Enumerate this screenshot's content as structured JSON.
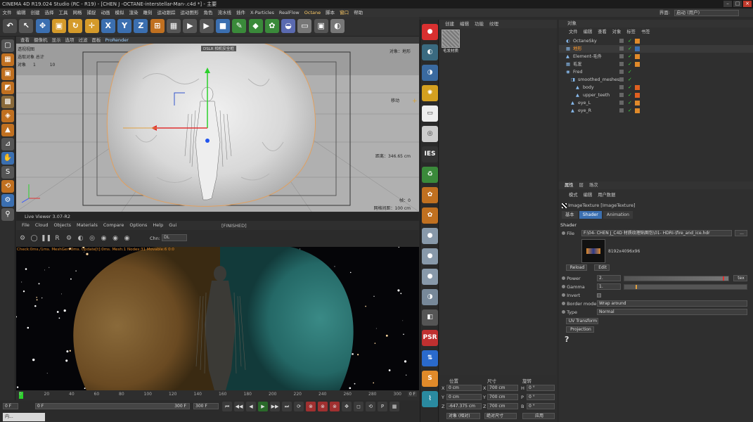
{
  "titlebar": {
    "title": "CINEMA 4D R19.024 Studio (RC - R19) - [CHEN J -OCTANE-interstellar-Man-.c4d *] - 主要"
  },
  "menu": {
    "items": [
      "文件",
      "编辑",
      "创建",
      "选择",
      "工具",
      "网格",
      "捕捉",
      "动画",
      "模拟",
      "渲染",
      "雕刻",
      "运动跟踪",
      "运动图形",
      "角色",
      "流水线",
      "插件",
      "X-Particles",
      "RealFlow",
      "Octane",
      "脚本",
      "窗口",
      "帮助"
    ],
    "layout_label": "界面:",
    "layout_value": "启动 (用户)"
  },
  "toolbar": {
    "buttons": [
      "undo",
      "select",
      "move",
      "scale",
      "rotate",
      "move-axis",
      "X",
      "Y",
      "Z",
      "coord",
      "render-region",
      "render-view",
      "render",
      "cube",
      "pen",
      "subdivide",
      "array",
      "deformer",
      "floor",
      "camera",
      "light"
    ]
  },
  "viewport": {
    "menu": [
      "查看",
      "摄像机",
      "显示",
      "选项",
      "过滤",
      "面板",
      "ProRender"
    ],
    "name": "透视视图",
    "info_title": "选取对象 总计",
    "info_object_label": "对象",
    "info_object_count_sel": "1",
    "info_object_count_total": "10",
    "object_name_label": "对象：地形",
    "move_label": "移动",
    "distance": "距离：346.65 cm",
    "frame": "帧：0",
    "grid": "网格间距：100 cm",
    "safe_label": "DSLR 相机安全框"
  },
  "liveviewer": {
    "title": "Live Viewer 3.07-R2",
    "menu": [
      "File",
      "Cloud",
      "Objects",
      "Materials",
      "Compare",
      "Options",
      "Help",
      "Gui"
    ],
    "status": "[FINISHED]",
    "channel_label": "Chn:",
    "channel_value": "DL",
    "stats": "Check:0ms./1ms. MeshGen:0ms. Update[t]:0ms. Mesh:1 Nodes:31 Movable:6  0:0"
  },
  "timeline": {
    "ticks": [
      "0",
      "20",
      "40",
      "60",
      "80",
      "100",
      "120",
      "140",
      "160",
      "180",
      "200",
      "220",
      "240",
      "260",
      "280",
      "300"
    ],
    "current_frame": "0 F",
    "start": "0 F",
    "min": "0 F",
    "max": "300 F",
    "end": "300 F"
  },
  "materials": {
    "menu": [
      "创建",
      "编辑",
      "功能",
      "纹理"
    ],
    "items": [
      {
        "name": "毛发材质"
      }
    ]
  },
  "coords": {
    "headers": [
      "位置",
      "尺寸",
      "旋转"
    ],
    "rows": [
      {
        "axis": "X",
        "pos": "0 cm",
        "size": "700 cm",
        "rot_label": "H",
        "rot": "0 °"
      },
      {
        "axis": "Y",
        "pos": "0 cm",
        "size": "700 cm",
        "rot_label": "P",
        "rot": "0 °"
      },
      {
        "axis": "Z",
        "pos": "-647.375 cm",
        "size": "700 cm",
        "rot_label": "B",
        "rot": "0 °"
      }
    ],
    "mode1": "对象 (相对)",
    "mode2": "绝对尺寸",
    "apply": "应用"
  },
  "objects": {
    "title": "对象",
    "menu": [
      "文件",
      "编辑",
      "查看",
      "对象",
      "标签",
      "书签"
    ],
    "rows": [
      {
        "name": "OctaneSky",
        "indent": 0,
        "color": "#c8c8c8"
      },
      {
        "name": "地形",
        "indent": 0,
        "color": "#ff9a2e"
      },
      {
        "name": "Element-毛件",
        "indent": 0,
        "color": "#c8c8c8"
      },
      {
        "name": "毛发",
        "indent": 0,
        "color": "#c8c8c8"
      },
      {
        "name": "Fred",
        "indent": 0,
        "color": "#c8c8c8"
      },
      {
        "name": "smoothed_meshes",
        "indent": 1,
        "color": "#c8c8c8"
      },
      {
        "name": "body",
        "indent": 2,
        "color": "#c8c8c8"
      },
      {
        "name": "upper_teeth",
        "indent": 2,
        "color": "#c8c8c8"
      },
      {
        "name": "eye_L",
        "indent": 1,
        "color": "#c8c8c8"
      },
      {
        "name": "eye_R",
        "indent": 1,
        "color": "#c8c8c8"
      }
    ]
  },
  "attributes": {
    "tabs": [
      "属性",
      "层",
      "场次"
    ],
    "menu": [
      "模式",
      "编辑",
      "用户数据"
    ],
    "node_title": "ImageTexture [ImageTexture]",
    "subtabs": [
      "基本",
      "Shader",
      "Animation"
    ],
    "section": "Shader",
    "file_label": "File",
    "file_path": "F:\\04- CHEN J_C4D 材质纹理贴图包\\01- HDRI-\\fire_and_ice.hdr",
    "resolution": "8192x4096x96",
    "reload": "Reload",
    "edit": "Edit",
    "power_label": "Power",
    "power_value": "2.",
    "tex_button": "tex",
    "gamma_label": "Gamma",
    "gamma_value": "1.",
    "invert_label": "Invert",
    "border_label": "Border mode",
    "border_value": "Wrap around",
    "type_label": "Type",
    "type_value": "Normal",
    "uv_button": "UV Transform",
    "projection_button": "Projection",
    "help": "?"
  },
  "taskbar": {
    "label": "内..."
  },
  "colors": {
    "accent": "#ff9a2e",
    "octane_red": "#d93030",
    "selection_blue": "#3b6fb0"
  }
}
